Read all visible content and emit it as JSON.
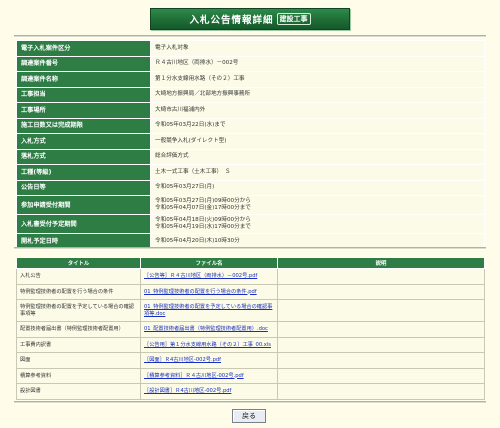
{
  "header": {
    "title": "入札公告情報詳細",
    "subtitle": "建設工事"
  },
  "info_rows": [
    {
      "label": "電子入札案件区分",
      "value": "電子入札対象"
    },
    {
      "label": "調達案件番号",
      "value": "Ｒ４古川地区（両排水）－002号"
    },
    {
      "label": "調達案件名称",
      "value": "第１分水支線用水路（その２）工事"
    },
    {
      "label": "工事担当",
      "value": "大崎地方振興局／北部地方振興事務所"
    },
    {
      "label": "工事場所",
      "value": "大崎市古川福浦内外"
    },
    {
      "label": "施工日数又は完成期限",
      "value": "令和05年03月22日(水)まで"
    },
    {
      "label": "入札方式",
      "value": "一般競争入札(ダイレクト型)"
    },
    {
      "label": "落札方式",
      "value": "総合評価方式"
    },
    {
      "label": "工種(等級)",
      "value": "土木一式工事（土木工事）　Ｓ"
    },
    {
      "label": "公告日等",
      "value": "令和05年03月27日(月)"
    },
    {
      "label": "参加申請受付期間",
      "value_line1": "令和05年03月27日(月)09時00分から",
      "value_line2": "令和05年04月07日(金)17時00分まで"
    },
    {
      "label": "入札書受付予定期間",
      "value_line1": "令和05年04月18日(火)09時00分から",
      "value_line2": "令和05年04月19日(水)17時00分まで"
    },
    {
      "label": "開札予定日時",
      "value": "令和05年04月20日(木)10時30分"
    }
  ],
  "files_table": {
    "headers": [
      "タイトル",
      "ファイル名",
      "説明"
    ],
    "rows": [
      {
        "title": "入札公告",
        "file": "［公告等］Ｒ４古川地区（両排水）－002号.pdf",
        "desc": ""
      },
      {
        "title": "特例監理技術者の配置を行う場合の条件",
        "file": "01_特例監理技術者の配置を行う場合の条件.pdf",
        "desc": ""
      },
      {
        "title": "特例監理技術者の配置を予定している場合の確認事項等",
        "file": "01_特例監理技術者の配置を予定している場合の確認事項等.doc",
        "desc": ""
      },
      {
        "title": "配置技術者届出書（特例監理技術者配置用）",
        "file": "01_配置技術者届出書（特例監理技術者配置用）.doc",
        "desc": ""
      },
      {
        "title": "工事費内訳書",
        "file": "［公告用］第１分水支線用水路（その２）工事_00.xls",
        "desc": ""
      },
      {
        "title": "図面",
        "file": "［図面］Ｒ4古川地区-002号.pdf",
        "desc": ""
      },
      {
        "title": "積算参考資料",
        "file": "［積算参考資料］Ｒ４古川地区-002号.pdf",
        "desc": ""
      },
      {
        "title": "設計図書",
        "file": "［設計図書］Ｒ4古川地区-002号.pdf",
        "desc": ""
      }
    ]
  },
  "back_button": "戻る",
  "colors": {
    "background": "#fffdea",
    "header_green": "#2d7d45",
    "link_blue": "#1a2fbf"
  }
}
